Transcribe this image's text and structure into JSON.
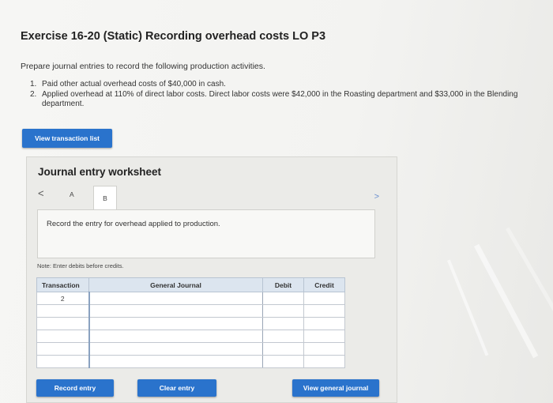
{
  "exercise": {
    "title": "Exercise 16-20 (Static) Recording overhead costs LO P3",
    "prompt": "Prepare journal entries to record the following production activities.",
    "steps": [
      {
        "num": "1.",
        "text": "Paid other actual overhead costs of $40,000 in cash."
      },
      {
        "num": "2.",
        "text": "Applied overhead at 110% of direct labor costs. Direct labor costs were $42,000 in the Roasting department and $33,000 in the Blending department."
      }
    ]
  },
  "buttons": {
    "view_transactions": "View transaction list",
    "record_entry": "Record entry",
    "clear_entry": "Clear entry",
    "view_journal": "View general journal"
  },
  "worksheet": {
    "title": "Journal entry worksheet",
    "nav_prev": "<",
    "nav_next": ">",
    "tabs": [
      "A",
      "B"
    ],
    "active_tab": "B",
    "instruction": "Record the entry for overhead applied to production.",
    "note": "Note: Enter debits before credits.",
    "table": {
      "headers": [
        "Transaction",
        "General Journal",
        "Debit",
        "Credit"
      ],
      "rows": [
        {
          "transaction": "2",
          "account": "",
          "debit": "",
          "credit": ""
        },
        {
          "transaction": "",
          "account": "",
          "debit": "",
          "credit": ""
        },
        {
          "transaction": "",
          "account": "",
          "debit": "",
          "credit": ""
        },
        {
          "transaction": "",
          "account": "",
          "debit": "",
          "credit": ""
        },
        {
          "transaction": "",
          "account": "",
          "debit": "",
          "credit": ""
        },
        {
          "transaction": "",
          "account": "",
          "debit": "",
          "credit": ""
        }
      ]
    }
  },
  "colors": {
    "button_blue": "#2a73cc",
    "table_header": "#dce5ef"
  }
}
